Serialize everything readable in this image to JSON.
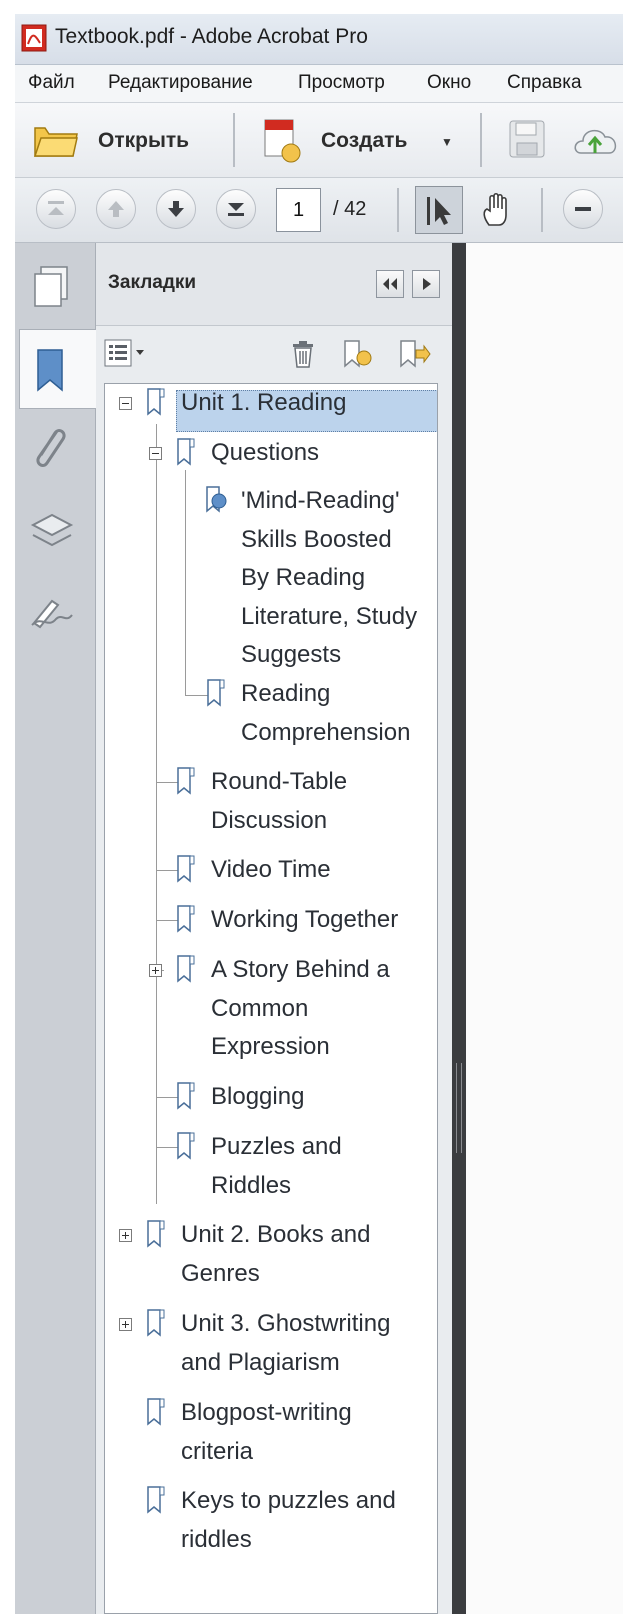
{
  "window": {
    "title": "Textbook.pdf - Adobe Acrobat Pro"
  },
  "menu": {
    "items": [
      "Файл",
      "Редактирование",
      "Просмотр",
      "Окно",
      "Справка"
    ]
  },
  "toolbar": {
    "open_label": "Открыть",
    "create_label": "Создать"
  },
  "navigation": {
    "page_value": "1",
    "page_total": "/ 42"
  },
  "bookmarks": {
    "title": "Закладки",
    "items": [
      {
        "lines": [
          "Unit 1. Reading"
        ],
        "level": 0,
        "expander": "minus",
        "selected": true
      },
      {
        "lines": [
          "Questions"
        ],
        "level": 1,
        "expander": "minus"
      },
      {
        "lines": [
          "'Mind-Reading'",
          "Skills Boosted",
          "By Reading",
          "Literature, Study",
          "Suggests"
        ],
        "level": 2,
        "icon": "web-link"
      },
      {
        "lines": [
          "Reading",
          "Comprehension"
        ],
        "level": 2
      },
      {
        "lines": [
          "Round-Table",
          "Discussion"
        ],
        "level": 1
      },
      {
        "lines": [
          "Video Time"
        ],
        "level": 1
      },
      {
        "lines": [
          "Working Together"
        ],
        "level": 1
      },
      {
        "lines": [
          "A Story Behind a",
          "Common",
          "Expression"
        ],
        "level": 1,
        "expander": "plus"
      },
      {
        "lines": [
          "Blogging"
        ],
        "level": 1
      },
      {
        "lines": [
          "Puzzles and",
          "Riddles"
        ],
        "level": 1
      },
      {
        "lines": [
          "Unit 2. Books and",
          "Genres"
        ],
        "level": 0,
        "expander": "plus"
      },
      {
        "lines": [
          "Unit 3. Ghostwriting",
          "and Plagiarism"
        ],
        "level": 0,
        "expander": "plus"
      },
      {
        "lines": [
          "Blogpost-writing",
          "criteria"
        ],
        "level": 0
      },
      {
        "lines": [
          "Keys to puzzles and",
          "riddles"
        ],
        "level": 0
      }
    ]
  },
  "icons": {
    "app": "acrobat-icon",
    "open": "folder-open-icon",
    "create": "create-pdf-icon",
    "save": "save-icon",
    "cloud": "cloud-upload-icon",
    "first": "first-page-icon",
    "prev": "previous-page-icon",
    "next": "next-page-icon",
    "last": "last-page-icon",
    "select": "select-tool-icon",
    "hand": "hand-tool-icon",
    "zoom_out": "zoom-out-icon",
    "thumbnails": "page-thumbnails-icon",
    "bookmarks": "bookmarks-icon",
    "attachments": "attachments-icon",
    "layers": "layers-icon",
    "signatures": "signatures-icon"
  },
  "colors": {
    "selection": "#bcd3ec",
    "panel_background": "#e9ecef",
    "splitter": "#3b3d40"
  }
}
